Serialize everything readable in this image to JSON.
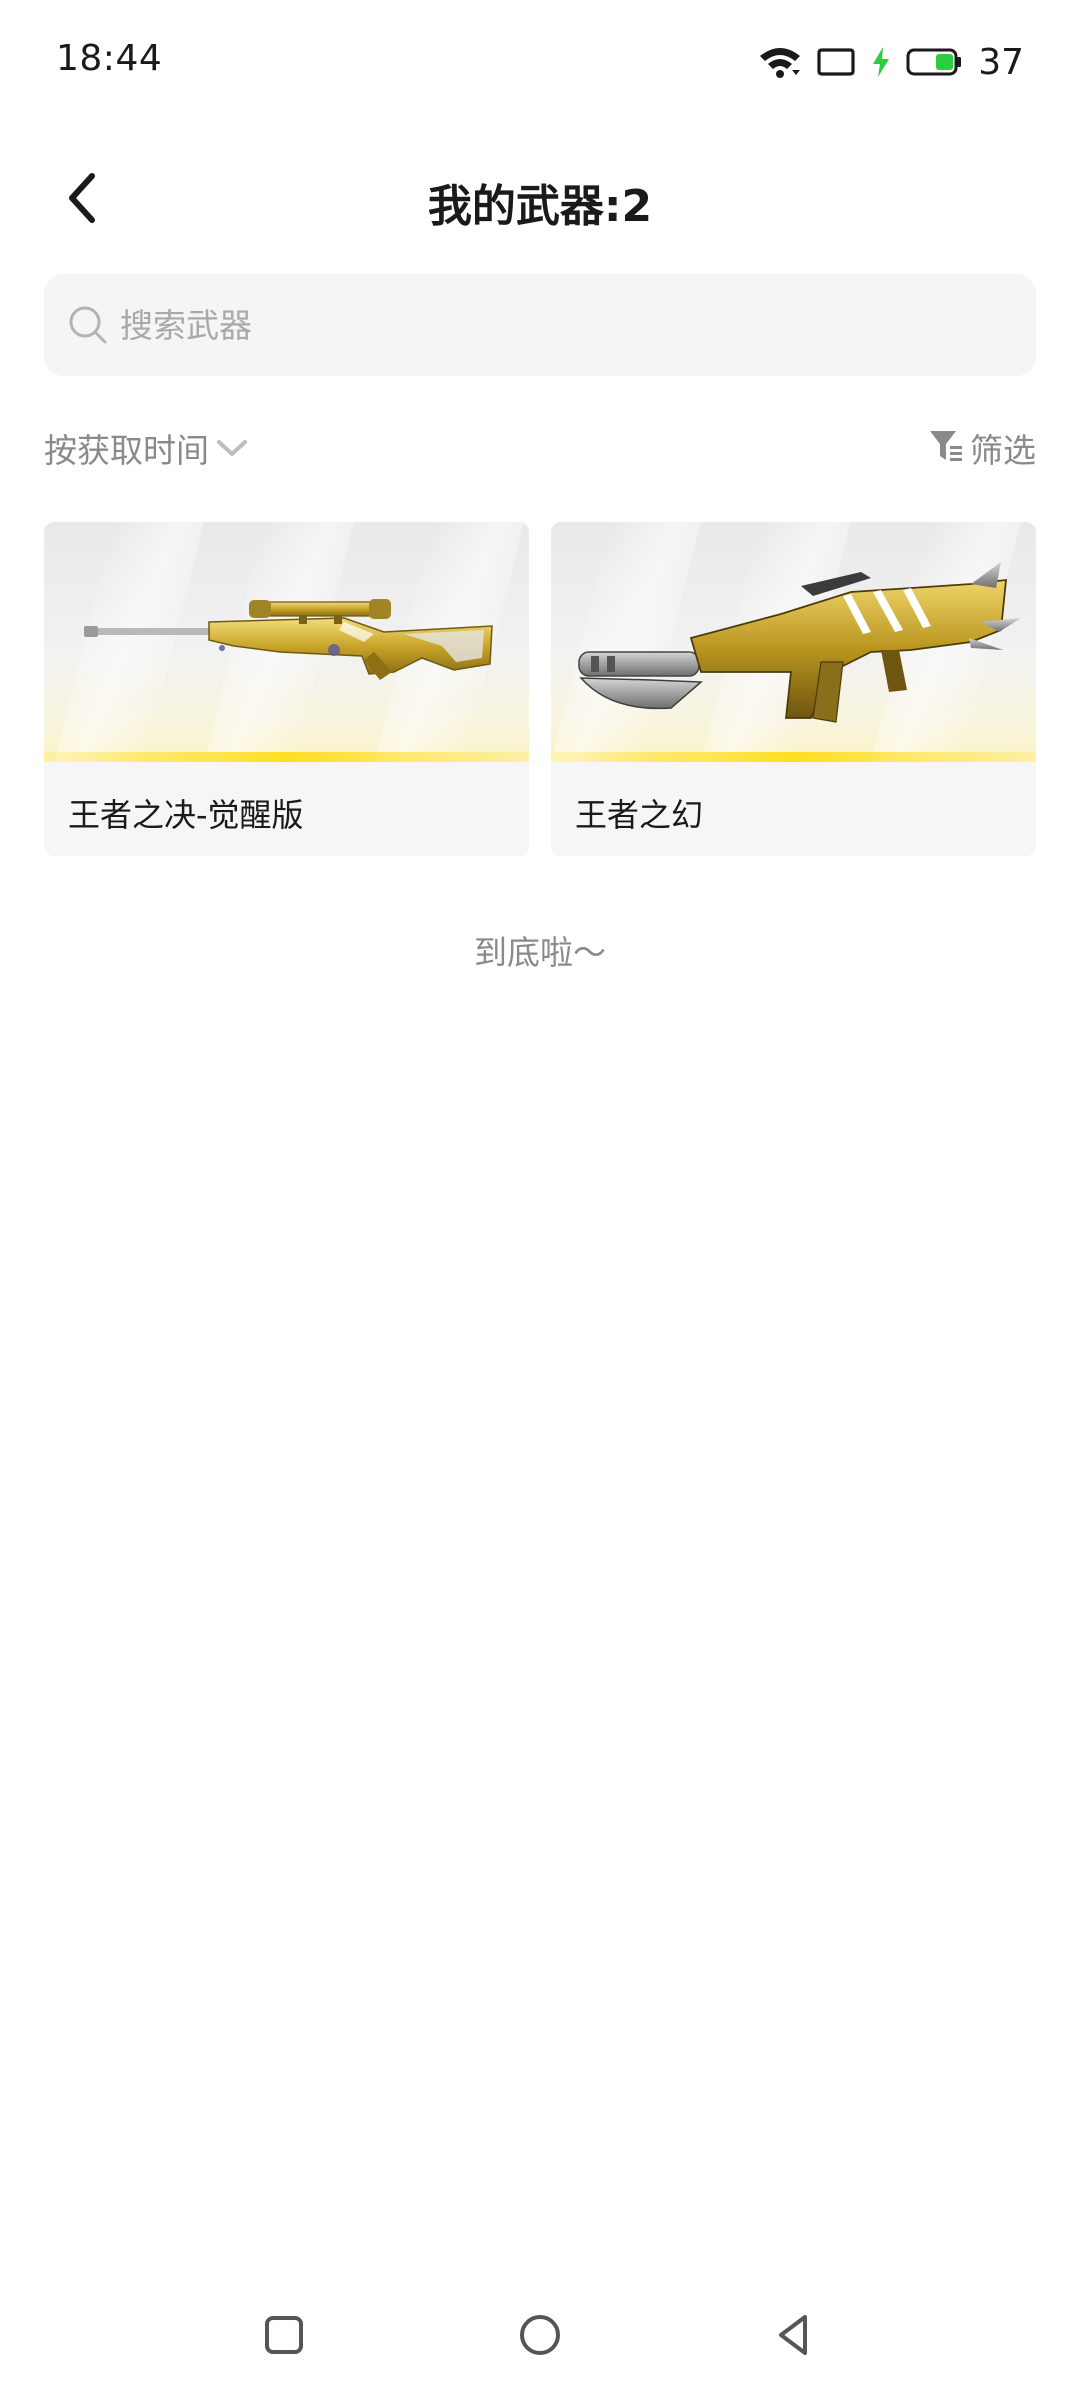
{
  "status_bar": {
    "time": "18:44",
    "battery_level": "37",
    "icons": [
      "wifi-icon",
      "screen-cast-icon",
      "charging-icon",
      "battery-icon"
    ],
    "battery_color": "#2ecc40"
  },
  "header": {
    "back_icon": "chevron-left-icon",
    "title": "我的武器:2"
  },
  "search": {
    "icon": "search-icon",
    "placeholder": "搜索武器",
    "value": ""
  },
  "toolbar": {
    "sort_label": "按获取时间",
    "sort_icon": "chevron-down-icon",
    "filter_label": "筛选",
    "filter_icon": "filter-icon"
  },
  "weapons": [
    {
      "name": "王者之决-觉醒版",
      "image": "sniper-rifle-gold",
      "rarity_color": "#ffde21"
    },
    {
      "name": "王者之幻",
      "image": "assault-rifle-gold",
      "rarity_color": "#ffde21"
    }
  ],
  "list_end_text": "到底啦～",
  "nav_bar": {
    "items": [
      "recents-square-icon",
      "home-circle-icon",
      "back-triangle-icon"
    ]
  },
  "colors": {
    "background": "#ffffff",
    "search_bg": "#f5f5f5",
    "secondary_text": "#8a8a8a",
    "accent_gold": "#ffde21"
  }
}
